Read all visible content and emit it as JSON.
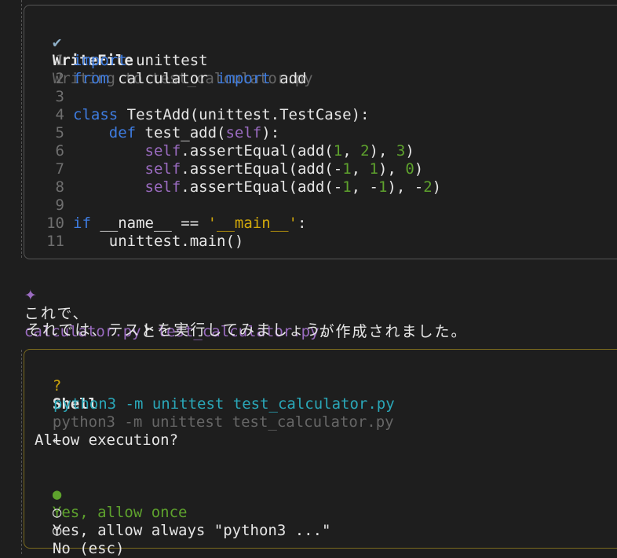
{
  "write_file": {
    "status_icon": "✔",
    "tool_name": "WriteFile",
    "description": "Writing to test_calculator.py",
    "code_lines": [
      {
        "n": "1",
        "tokens": [
          {
            "t": "import",
            "c": "kw"
          },
          {
            "t": " unittest",
            "c": ""
          }
        ]
      },
      {
        "n": "2",
        "tokens": [
          {
            "t": "from",
            "c": "kw"
          },
          {
            "t": " calculator ",
            "c": ""
          },
          {
            "t": "import",
            "c": "kw"
          },
          {
            "t": " add",
            "c": ""
          }
        ]
      },
      {
        "n": "3",
        "tokens": []
      },
      {
        "n": "4",
        "tokens": [
          {
            "t": "class",
            "c": "kw"
          },
          {
            "t": " TestAdd(unittest.TestCase):",
            "c": ""
          }
        ]
      },
      {
        "n": "5",
        "tokens": [
          {
            "t": "    ",
            "c": ""
          },
          {
            "t": "def",
            "c": "kw"
          },
          {
            "t": " test_add(",
            "c": ""
          },
          {
            "t": "self",
            "c": "slf"
          },
          {
            "t": "):",
            "c": ""
          }
        ]
      },
      {
        "n": "6",
        "tokens": [
          {
            "t": "        ",
            "c": ""
          },
          {
            "t": "self",
            "c": "slf"
          },
          {
            "t": ".assertEqual(add(",
            "c": ""
          },
          {
            "t": "1",
            "c": "num"
          },
          {
            "t": ", ",
            "c": ""
          },
          {
            "t": "2",
            "c": "num"
          },
          {
            "t": "), ",
            "c": ""
          },
          {
            "t": "3",
            "c": "num"
          },
          {
            "t": ")",
            "c": ""
          }
        ]
      },
      {
        "n": "7",
        "tokens": [
          {
            "t": "        ",
            "c": ""
          },
          {
            "t": "self",
            "c": "slf"
          },
          {
            "t": ".assertEqual(add(-",
            "c": ""
          },
          {
            "t": "1",
            "c": "num"
          },
          {
            "t": ", ",
            "c": ""
          },
          {
            "t": "1",
            "c": "num"
          },
          {
            "t": "), ",
            "c": ""
          },
          {
            "t": "0",
            "c": "num"
          },
          {
            "t": ")",
            "c": ""
          }
        ]
      },
      {
        "n": "8",
        "tokens": [
          {
            "t": "        ",
            "c": ""
          },
          {
            "t": "self",
            "c": "slf"
          },
          {
            "t": ".assertEqual(add(-",
            "c": ""
          },
          {
            "t": "1",
            "c": "num"
          },
          {
            "t": ", -",
            "c": ""
          },
          {
            "t": "1",
            "c": "num"
          },
          {
            "t": "), -",
            "c": ""
          },
          {
            "t": "2",
            "c": "num"
          },
          {
            "t": ")",
            "c": ""
          }
        ]
      },
      {
        "n": "9",
        "tokens": []
      },
      {
        "n": "10",
        "tokens": [
          {
            "t": "if",
            "c": "kw"
          },
          {
            "t": " __name__ == ",
            "c": ""
          },
          {
            "t": "'__main__'",
            "c": "str"
          },
          {
            "t": ":",
            "c": ""
          }
        ]
      },
      {
        "n": "11",
        "tokens": [
          {
            "t": "    unittest.main()",
            "c": ""
          }
        ]
      }
    ]
  },
  "message1": {
    "icon": "✦",
    "prefix": "これで、",
    "file1": "calculator.py",
    "mid": "と",
    "file2": "test_calculator.py",
    "suffix": "が作成されました。"
  },
  "message2": {
    "text": "それでは、テストを実行してみましょう。"
  },
  "shell": {
    "status_icon": "?",
    "tool_name": "Shell",
    "description": "python3 -m unittest test_calculator.py",
    "arrow": "←",
    "command": "python3 -m unittest test_calculator.py",
    "prompt": "Allow execution?",
    "options": [
      {
        "bullet": "●",
        "label": "Yes, allow once",
        "selected": true
      },
      {
        "bullet": "○",
        "label": "Yes, allow always \"python3 ...\"",
        "selected": false
      },
      {
        "bullet": "○",
        "label": "No (esc)",
        "selected": false
      }
    ]
  },
  "colors": {
    "background": "#1e1e1e",
    "keyword": "#3e7ce0",
    "self": "#9a6bc0",
    "number": "#5ea22d",
    "string": "#d1a80b",
    "accent_purple": "#9a6bc0",
    "command_cyan": "#2aa7b8",
    "selected_green": "#5ea22d"
  }
}
